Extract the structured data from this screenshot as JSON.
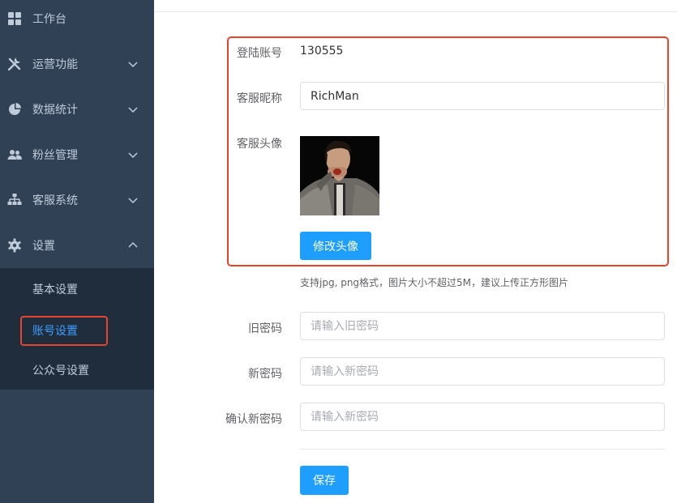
{
  "sidebar": {
    "menu": [
      {
        "label": "工作台",
        "icon": "dashboard-icon"
      },
      {
        "label": "运营功能",
        "icon": "tools-icon"
      },
      {
        "label": "数据统计",
        "icon": "pie-chart-icon"
      },
      {
        "label": "粉丝管理",
        "icon": "users-icon"
      },
      {
        "label": "客服系统",
        "icon": "org-chart-icon"
      },
      {
        "label": "设置",
        "icon": "gear-icon"
      }
    ],
    "submenu": [
      {
        "label": "基本设置"
      },
      {
        "label": "账号设置"
      },
      {
        "label": "公众号设置"
      }
    ]
  },
  "form": {
    "login_account_label": "登陆账号",
    "login_account_value": "130555",
    "nickname_label": "客服昵称",
    "nickname_value": "RichMan",
    "avatar_label": "客服头像",
    "change_avatar_label": "修改头像",
    "avatar_hint": "支持jpg, png格式，图片大小不超过5M，建议上传正方形图片",
    "old_password_label": "旧密码",
    "old_password_placeholder": "请输入旧密码",
    "new_password_label": "新密码",
    "new_password_placeholder": "请输入新密码",
    "confirm_password_label": "确认新密码",
    "confirm_password_placeholder": "请输入新密码",
    "save_label": "保存"
  },
  "colors": {
    "sidebar_bg": "#304156",
    "submenu_bg": "#1f2d3d",
    "sidebar_text": "#bfcbd9",
    "active_text": "#409eff",
    "primary_button": "#1e9fff",
    "highlight_border": "#e8432f"
  }
}
